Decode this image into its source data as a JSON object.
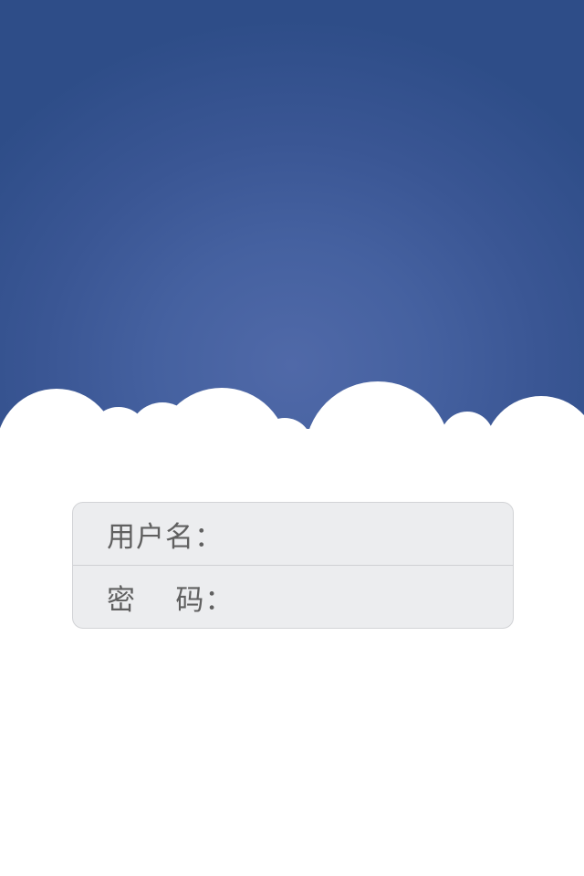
{
  "login_form": {
    "username": {
      "label": "用户名：",
      "value": "",
      "placeholder": ""
    },
    "password": {
      "label": "密    码：",
      "value": "",
      "placeholder": ""
    }
  },
  "colors": {
    "sky_center": "#5069a8",
    "sky_edge": "#2e4d88",
    "cloud": "#ffffff",
    "panel_background": "#ecedef",
    "panel_border": "#d2d3d6",
    "label_text": "#606060"
  }
}
